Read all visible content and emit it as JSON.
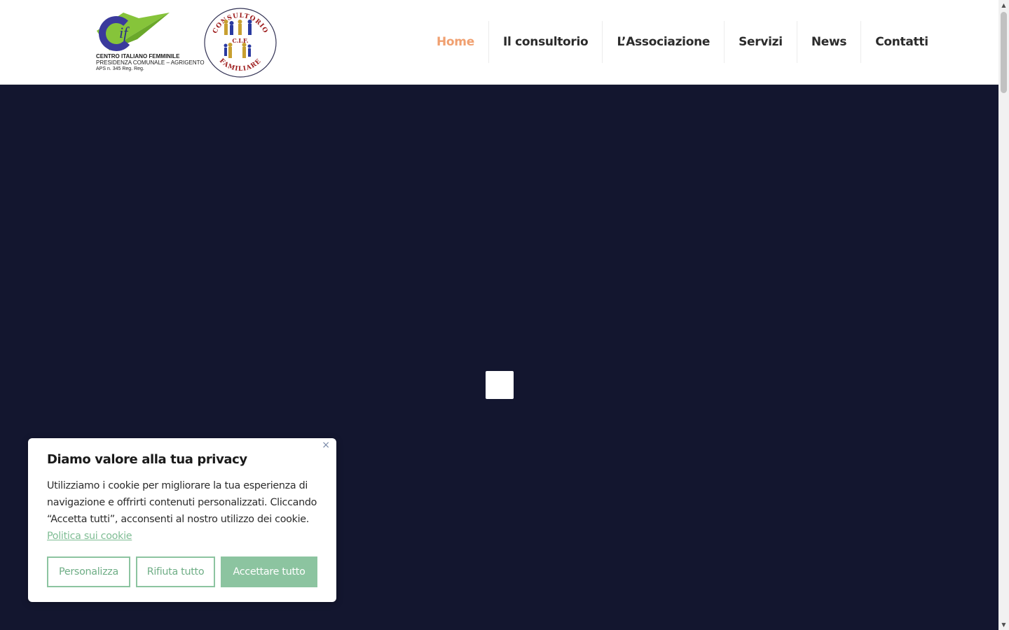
{
  "header": {
    "cif_logo": {
      "line1": "CENTRO ITALIANO FEMMINILE",
      "line2": "PRESIDENZA COMUNALE – AGRIGENTO",
      "line3": "APS n. 345 Reg. Reg."
    },
    "consultorio_logo": {
      "top_text": "CONSULTORIO",
      "middle_text": "C.I.F.",
      "bottom_text": "FAMILIARE"
    },
    "nav": [
      {
        "label": "Home",
        "active": true
      },
      {
        "label": "Il consultorio"
      },
      {
        "label": "L’Associazione"
      },
      {
        "label": "Servizi"
      },
      {
        "label": "News"
      },
      {
        "label": "Contatti"
      }
    ]
  },
  "cookie_banner": {
    "title": "Diamo valore alla tua privacy",
    "text": "Utilizziamo i cookie per migliorare la tua esperienza di navigazione e offrirti contenuti personalizzati. Cliccando “Accetta tutti”, acconsenti al nostro utilizzo dei cookie. ",
    "policy_link": "Politica sui cookie",
    "close_glyph": "×",
    "buttons": {
      "customize": "Personalizza",
      "reject": "Rifiuta tutto",
      "accept": "Accettare tutto"
    }
  },
  "colors": {
    "hero_background": "#13162f",
    "nav_active": "#f0a070",
    "cookie_accent": "#8cc4a0"
  },
  "icons": {
    "close": "close-icon",
    "scroll_up": "scroll-up-arrow-icon",
    "scroll_down": "scroll-down-arrow-icon"
  }
}
